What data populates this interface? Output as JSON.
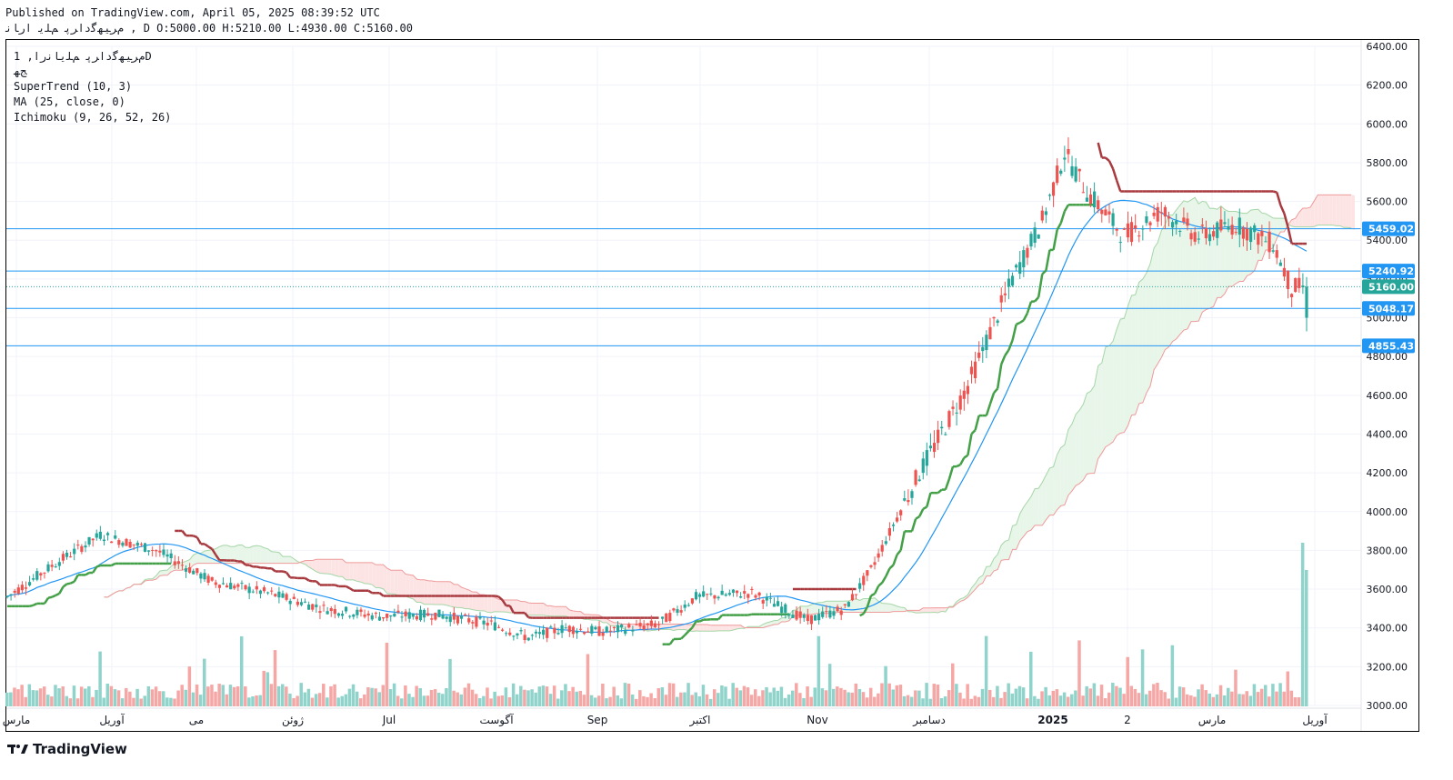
{
  "header": {
    "published": "Published on TradingView.com, April 05, 2025 08:39:52 UTC",
    "ohlc_line": "ﻡﺮﯿﻬﮔﺩﺍﺮﭘ ﻢﻠﯾ ﺍﺭﺎﻧ ,  D O:5000.00 H:5210.00 L:4930.00 C:5160.00"
  },
  "legend": {
    "symbol": "ﻡﺮﯿﻬﮔﺩﺍﺮﭘ ﻢﻠﯾﺎﻧﺭﺍ, 1D",
    "symbol_sub": "ﺞﻬ",
    "supertrend": "SuperTrend (10, 3)",
    "ma": "MA (25, close, 0)",
    "ichimoku": "Ichimoku (9, 26, 52, 26)"
  },
  "brand": "TradingView",
  "colors": {
    "up": "#26a69a",
    "down": "#ef5350",
    "supertrend_up": "#43a047",
    "supertrend_down": "#a83a3f",
    "ma": "#2196f3",
    "hline": "#2196f3",
    "cloud_green": "#e8f5e9",
    "cloud_red": "#fde4e4"
  },
  "chart_data": {
    "type": "candlestick",
    "timeframe": "1D",
    "y_axis": {
      "min": 3000,
      "max": 6400,
      "ticks": [
        "6400.00",
        "6200.00",
        "6000.00",
        "5800.00",
        "5600.00",
        "5400.00",
        "5200.00",
        "5000.00",
        "4800.00",
        "4600.00",
        "4400.00",
        "4200.00",
        "4000.00",
        "3800.00",
        "3600.00",
        "3400.00",
        "3200.00",
        "3000.00"
      ]
    },
    "x_axis_labels": [
      "ﻣﺎﺭﺱ",
      "ﺁﻭﺭﯾﻞ",
      "ﻣﯽ",
      "ﮊﻭﺋﻦ",
      "Jul",
      "ﺁﮔﻮﺳﺖ",
      "Sep",
      "ﺍﮐﺘﺒﺮ",
      "Nov",
      "ﺩﺳﺎﻣﺒﺮ",
      "2025",
      "2",
      "ﻣﺎﺭﺱ",
      "ﺁﻭﺭﯾﻞ"
    ],
    "horizontal_levels": [
      {
        "value": 5459.02,
        "label": "5459.02"
      },
      {
        "value": 5240.92,
        "label": "5240.92"
      },
      {
        "value": 5048.17,
        "label": "5048.17"
      },
      {
        "value": 4855.43,
        "label": "4855.43"
      }
    ],
    "last_price": {
      "value": 5160.0,
      "label": "5160.00"
    },
    "last_bar": {
      "open": 5000.0,
      "high": 5210.0,
      "low": 4930.0,
      "close": 5160.0
    },
    "series": [
      {
        "name": "SuperTrend (10, 3)"
      },
      {
        "name": "MA (25, close, 0)"
      },
      {
        "name": "Ichimoku (9, 26, 52, 26)"
      }
    ]
  }
}
